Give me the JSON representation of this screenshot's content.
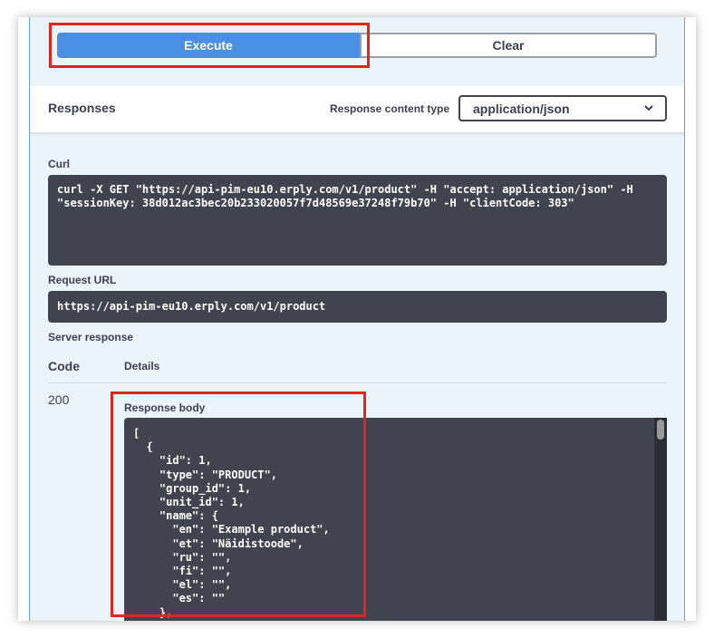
{
  "buttons": {
    "execute": "Execute",
    "clear": "Clear"
  },
  "responses": {
    "title": "Responses",
    "content_type_label": "Response content type",
    "content_type_value": "application/json"
  },
  "curl": {
    "label": "Curl",
    "command": "curl -X GET \"https://api-pim-eu10.erply.com/v1/product\" -H \"accept: application/json\" -H\n\"sessionKey: 38d012ac3bec20b233020057f7d48569e37248f79b70\" -H \"clientCode: 303\""
  },
  "request_url": {
    "label": "Request URL",
    "value": "https://api-pim-eu10.erply.com/v1/product"
  },
  "server_response": {
    "label": "Server response",
    "col_code": "Code",
    "col_details": "Details",
    "status_code": "200",
    "body_label": "Response body",
    "body": "[\n  {\n    \"id\": 1,\n    \"type\": \"PRODUCT\",\n    \"group_id\": 1,\n    \"unit_id\": 1,\n    \"name\": {\n      \"en\": \"Example product\",\n      \"et\": \"Näidistoode\",\n      \"ru\": \"\",\n      \"fi\": \"\",\n      \"el\": \"\",\n      \"es\": \"\"\n    },"
  },
  "colors": {
    "accent": "#4990e2",
    "highlight": "#e3261c",
    "code_bg": "#41444e"
  }
}
